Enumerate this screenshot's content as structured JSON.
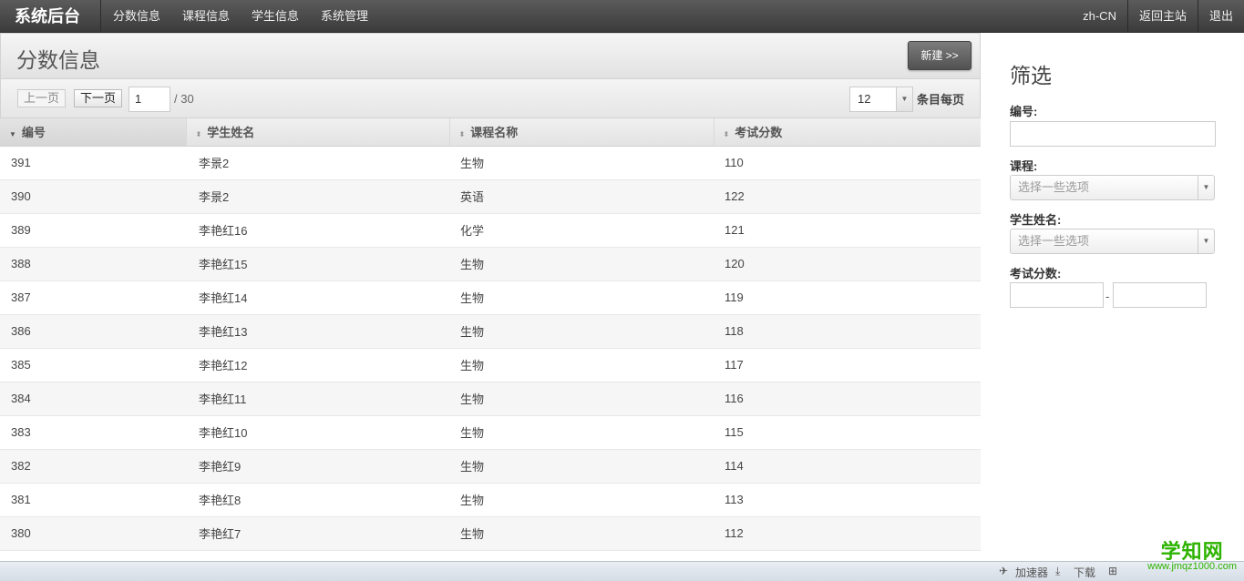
{
  "topbar": {
    "brand": "系统后台",
    "nav": [
      "分数信息",
      "课程信息",
      "学生信息",
      "系统管理"
    ],
    "lang": "zh-CN",
    "back": "返回主站",
    "logout": "退出"
  },
  "main": {
    "title": "分数信息",
    "new_button": "新建 >>",
    "pager": {
      "prev": "上一页",
      "next": "下一页",
      "page": "1",
      "total": "/ 30",
      "per_page": "12",
      "per_page_label": "条目每页"
    },
    "table": {
      "headers": [
        "编号",
        "学生姓名",
        "课程名称",
        "考试分数"
      ],
      "rows": [
        [
          "391",
          "李景2",
          "生物",
          "110"
        ],
        [
          "390",
          "李景2",
          "英语",
          "122"
        ],
        [
          "389",
          "李艳红16",
          "化学",
          "121"
        ],
        [
          "388",
          "李艳红15",
          "生物",
          "120"
        ],
        [
          "387",
          "李艳红14",
          "生物",
          "119"
        ],
        [
          "386",
          "李艳红13",
          "生物",
          "118"
        ],
        [
          "385",
          "李艳红12",
          "生物",
          "117"
        ],
        [
          "384",
          "李艳红11",
          "生物",
          "116"
        ],
        [
          "383",
          "李艳红10",
          "生物",
          "115"
        ],
        [
          "382",
          "李艳红9",
          "生物",
          "114"
        ],
        [
          "381",
          "李艳红8",
          "生物",
          "113"
        ],
        [
          "380",
          "李艳红7",
          "生物",
          "112"
        ]
      ]
    }
  },
  "filter": {
    "title": "筛选",
    "id_label": "编号:",
    "course_label": "课程:",
    "course_placeholder": "选择一些选项",
    "student_label": "学生姓名:",
    "student_placeholder": "选择一些选项",
    "score_label": "考试分数:",
    "range_sep": "-"
  },
  "statusbar": {
    "accelerator": "加速器",
    "download": "下载"
  },
  "watermark": {
    "big": "学知网",
    "small": "www.jmqz1000.com"
  }
}
